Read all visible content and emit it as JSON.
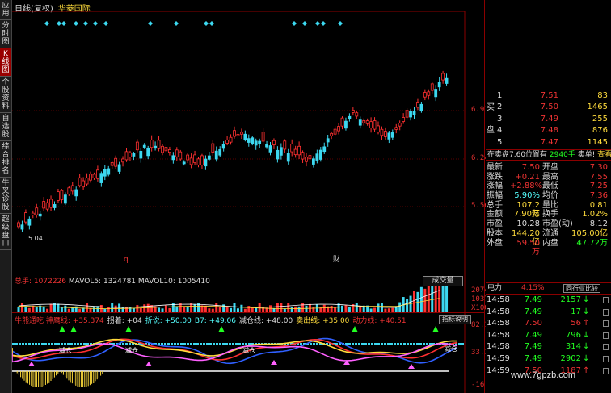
{
  "left_tabs": [
    "应用",
    "分时图",
    "K线图",
    "个股资料",
    "自选股",
    "综合排名",
    "牛叉诊股",
    "超级盘口"
  ],
  "header": {
    "period": "日线(复权)",
    "stock": "华菱国际"
  },
  "kline": {
    "price_labels": [
      "6.91",
      "6.24",
      "5.56"
    ],
    "bottom_markers": [
      "q",
      "财"
    ],
    "low_label": "5.04"
  },
  "volume": {
    "label": "总手:",
    "total": "1072226",
    "mavol5": "MAVOL5: 1324781",
    "mavol10": "MAVOL10: 1005410",
    "button": "成交量",
    "axis": [
      "20743",
      "10371",
      "X100"
    ]
  },
  "indicator": {
    "items": [
      {
        "text": "牛熊通吃 神鹰线: +35.374",
        "color": "#e33"
      },
      {
        "text": "拐着: +04",
        "color": "#ddd"
      },
      {
        "text": "折说: +50.00",
        "color": "#5ff"
      },
      {
        "text": "B7: +49.06",
        "color": "#5ff"
      },
      {
        "text": "减仓线: +48.00",
        "color": "#ddd"
      },
      {
        "text": "卖出线: +35.00",
        "color": "#ffdc3c"
      },
      {
        "text": "动力线: +40.51",
        "color": "#e33"
      }
    ],
    "button": "指标说明",
    "axis": [
      "82.14",
      "33.18",
      "-16.85"
    ],
    "labels": [
      "减仓",
      "减仓",
      "减仓",
      "减仓"
    ]
  },
  "order_book": {
    "side_label": [
      "买",
      "",
      "盘"
    ],
    "rows": [
      {
        "n": "1",
        "price": "7.51",
        "vol": "83"
      },
      {
        "n": "2",
        "price": "7.50",
        "vol": "1465"
      },
      {
        "n": "3",
        "price": "7.49",
        "vol": "255"
      },
      {
        "n": "4",
        "price": "7.48",
        "vol": "876"
      },
      {
        "n": "5",
        "price": "7.47",
        "vol": "1145"
      }
    ]
  },
  "bs_bar": {
    "sell": "在卖盘7.60位置有",
    "amount": "2940手",
    "mid": "卖单!",
    "link": "查看详细"
  },
  "stats": [
    {
      "l1": "最新",
      "v1": "7.50",
      "c1": "red",
      "l2": "开盘",
      "v2": "7.30",
      "c2": "red"
    },
    {
      "l1": "涨跌",
      "v1": "+0.21",
      "c1": "red",
      "l2": "最高",
      "v2": "7.55",
      "c2": "red"
    },
    {
      "l1": "涨幅",
      "v1": "+2.88%",
      "c1": "red",
      "l2": "最低",
      "v2": "7.25",
      "c2": "red"
    },
    {
      "l1": "振幅",
      "v1": "5.90%",
      "c1": "cyn",
      "l2": "均价",
      "v2": "7.36",
      "c2": "red"
    },
    {
      "l1": "总手",
      "v1": "107.2万",
      "c1": "yel",
      "l2": "量比",
      "v2": "0.81",
      "c2": "yel"
    },
    {
      "l1": "金额",
      "v1": "7.90亿",
      "c1": "yel",
      "l2": "换手",
      "v2": "1.02%",
      "c2": "yel"
    },
    {
      "l1": "市盈",
      "v1": "10.28",
      "c1": "wht",
      "l2": "市盈(动)",
      "v2": "8.12",
      "c2": "wht"
    },
    {
      "l1": "股本",
      "v1": "144.20亿",
      "c1": "yel",
      "l2": "流通",
      "v2": "105.00亿",
      "c2": "yel"
    },
    {
      "l1": "外盘",
      "v1": "59.50万",
      "c1": "red",
      "l2": "内盘",
      "v2": "47.72万",
      "c2": "grn"
    }
  ],
  "industry": {
    "name": "电力",
    "change": "4.15%",
    "button": "同行业比较"
  },
  "ticks": [
    {
      "t": "14:58",
      "p": "7.49",
      "pc": "grn",
      "v": "2157",
      "vc": "grn",
      "a": "↓",
      "ac": "grn"
    },
    {
      "t": "14:58",
      "p": "7.49",
      "pc": "grn",
      "v": "17",
      "vc": "grn",
      "a": "↓",
      "ac": "grn"
    },
    {
      "t": "14:58",
      "p": "7.50",
      "pc": "red",
      "v": "56",
      "vc": "red",
      "a": "↑",
      "ac": "red"
    },
    {
      "t": "14:58",
      "p": "7.49",
      "pc": "grn",
      "v": "796",
      "vc": "grn",
      "a": "↓",
      "ac": "grn"
    },
    {
      "t": "14:58",
      "p": "7.49",
      "pc": "grn",
      "v": "314",
      "vc": "grn",
      "a": "↓",
      "ac": "grn"
    },
    {
      "t": "14:59",
      "p": "7.49",
      "pc": "grn",
      "v": "2902",
      "vc": "grn",
      "a": "↓",
      "ac": "grn"
    },
    {
      "t": "14:59",
      "p": "7.50",
      "pc": "red",
      "v": "1187",
      "vc": "red",
      "a": "↑",
      "ac": "red"
    }
  ],
  "watermark": "www.7gpzb.com"
}
